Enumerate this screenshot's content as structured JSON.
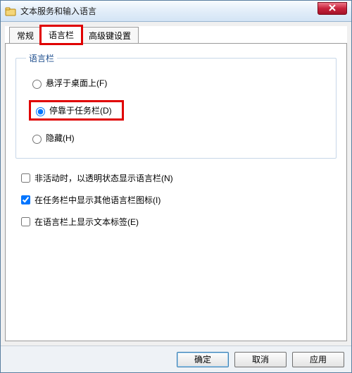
{
  "window": {
    "title": "文本服务和输入语言"
  },
  "tabs": {
    "general": "常规",
    "langbar": "语言栏",
    "advanced": "高级键设置"
  },
  "group": {
    "legend": "语言栏",
    "radio_float": "悬浮于桌面上(F)",
    "radio_dock": "停靠于任务栏(D)",
    "radio_hidden": "隐藏(H)"
  },
  "checks": {
    "inactive_transparent": "非活动时，以透明状态显示语言栏(N)",
    "show_extra_icons": "在任务栏中显示其他语言栏图标(I)",
    "show_text_labels": "在语言栏上显示文本标签(E)"
  },
  "buttons": {
    "ok": "确定",
    "cancel": "取消",
    "apply": "应用"
  },
  "state": {
    "active_tab": "langbar",
    "selected_radio": "dock",
    "checked": {
      "inactive_transparent": false,
      "show_extra_icons": true,
      "show_text_labels": false
    }
  }
}
